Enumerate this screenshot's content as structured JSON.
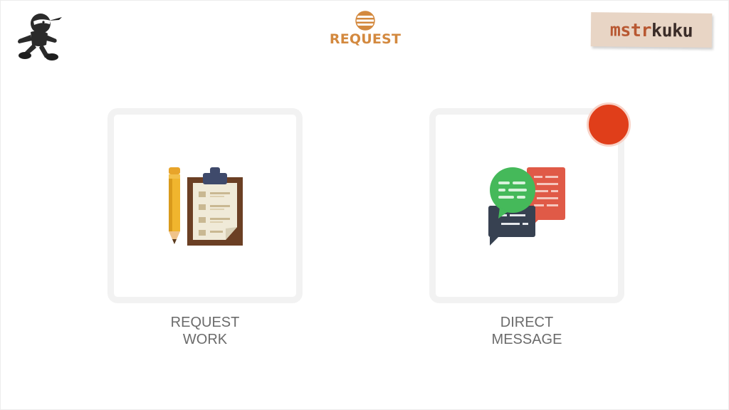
{
  "header": {
    "title": "REQUEST",
    "title_color": "#d3893f",
    "title_icon": "striped-circle-icon",
    "brand_part1": "mstr",
    "brand_part2": "kuku",
    "mascot_icon": "running-ninja-icon"
  },
  "cards": [
    {
      "icon": "clipboard-pencil-icon",
      "label_line1": "REQUEST",
      "label_line2": "WORK"
    },
    {
      "icon": "chat-bubbles-icon",
      "label_line1": "DIRECT",
      "label_line2": "MESSAGE",
      "badge_color": "#e03e1a"
    }
  ]
}
